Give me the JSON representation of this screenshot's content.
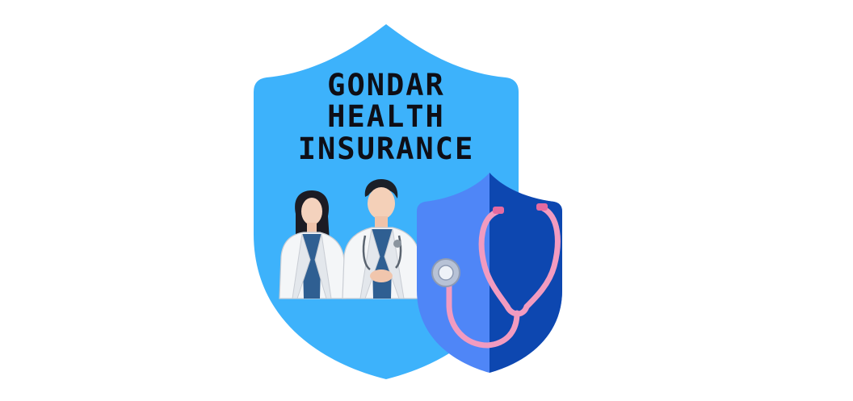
{
  "logo": {
    "title_lines": [
      "GONDAR",
      "HEALTH",
      "INSURANCE"
    ],
    "colors": {
      "background": "#ffffff",
      "big_shield": "#3db2fb",
      "small_shield_light": "#4f86f7",
      "small_shield_dark": "#0d47b0",
      "stethoscope_tube": "#f29bc0",
      "text": "#0e0e16"
    },
    "figures": [
      "female-doctor",
      "male-doctor"
    ],
    "icons": [
      "shield-icon",
      "stethoscope-icon"
    ]
  }
}
